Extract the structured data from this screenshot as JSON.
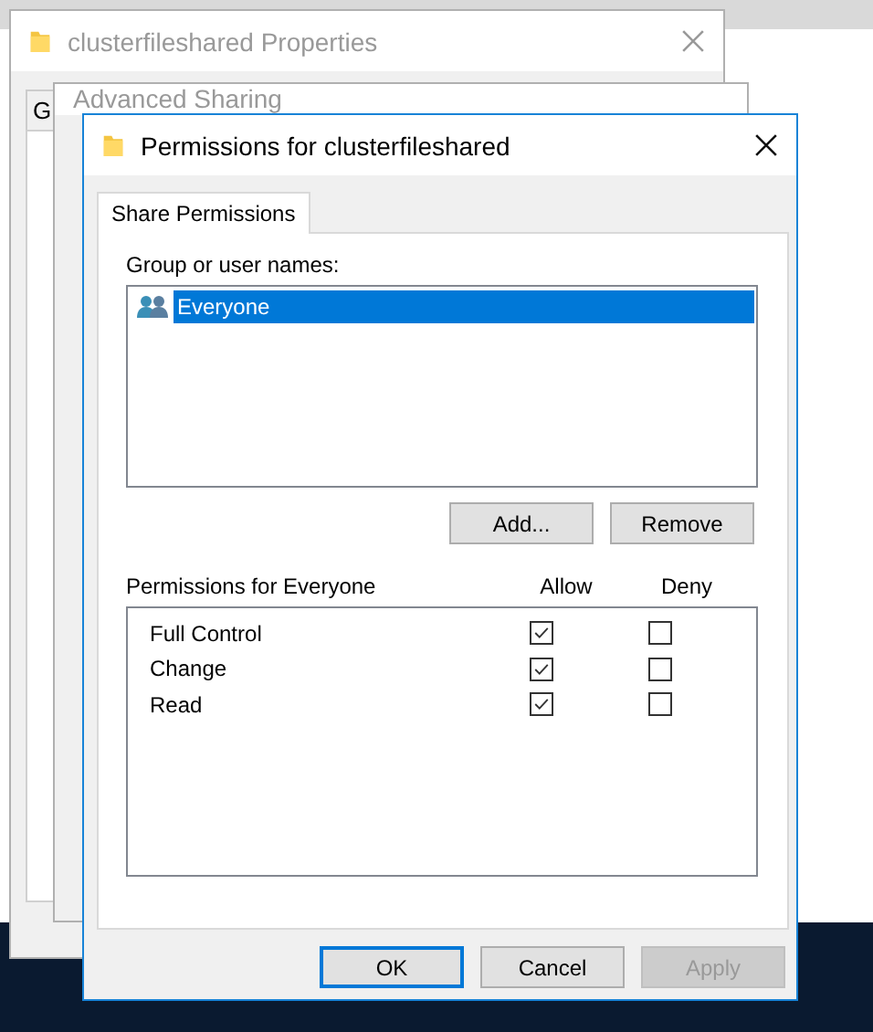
{
  "background_windows": [
    {
      "title": "clusterfileshared Properties",
      "tab": "G"
    },
    {
      "title": "Advanced Sharing"
    }
  ],
  "dialog": {
    "title": "Permissions for clusterfileshared",
    "tabs": [
      {
        "label": "Share Permissions",
        "selected": true
      }
    ],
    "group_label": "Group or user names:",
    "users": [
      {
        "name": "Everyone",
        "selected": true
      }
    ],
    "user_buttons": [
      {
        "label": "Add...",
        "disabled": false
      },
      {
        "label": "Remove",
        "disabled": false
      }
    ],
    "permissions_label": "Permissions for Everyone",
    "columns": [
      "Allow",
      "Deny"
    ],
    "permissions": [
      {
        "name": "Full Control",
        "allow": true,
        "deny": false
      },
      {
        "name": "Change",
        "allow": true,
        "deny": false
      },
      {
        "name": "Read",
        "allow": true,
        "deny": false
      }
    ],
    "buttons": [
      {
        "label": "OK",
        "default": true,
        "disabled": false
      },
      {
        "label": "Cancel",
        "default": false,
        "disabled": false
      },
      {
        "label": "Apply",
        "default": false,
        "disabled": true
      }
    ]
  }
}
